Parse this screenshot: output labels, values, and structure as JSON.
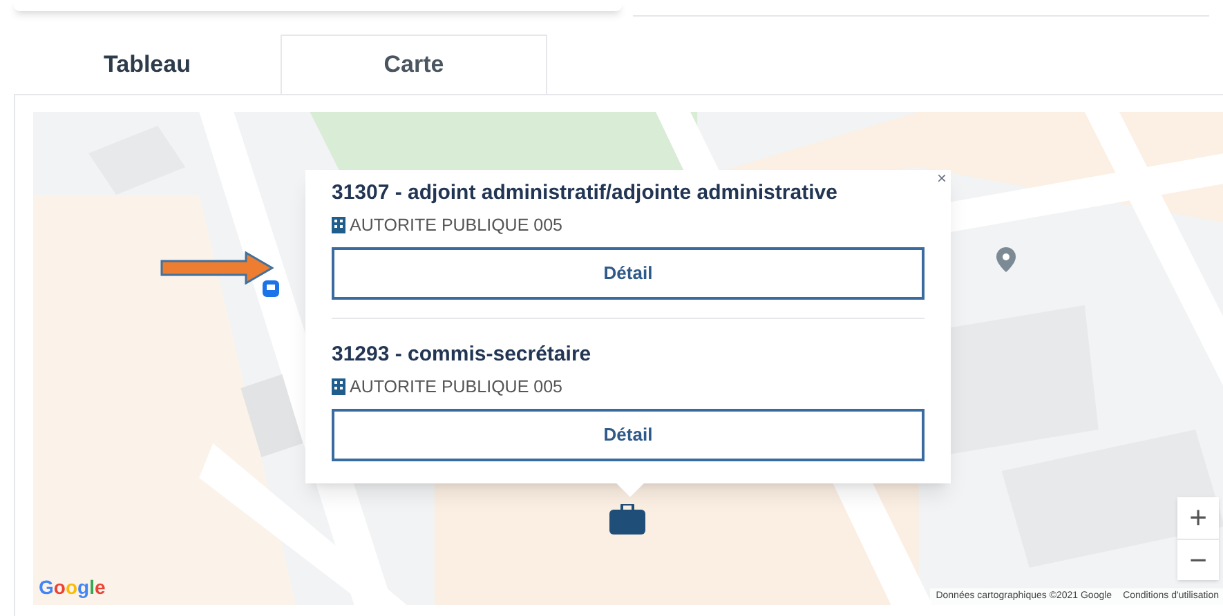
{
  "tabs": [
    {
      "label": "Tableau",
      "selected": false
    },
    {
      "label": "Carte",
      "selected": true
    }
  ],
  "map": {
    "popup": {
      "close": "×",
      "items": [
        {
          "title": "31307 - adjoint administratif/adjointe administrative",
          "employer": "AUTORITE PUBLIQUE 005",
          "button": "Détail"
        },
        {
          "title": "31293 - commis-secrétaire",
          "employer": "AUTORITE PUBLIQUE 005",
          "button": "Détail"
        }
      ]
    },
    "zoom": {
      "in": "+",
      "out": "−"
    },
    "logo": "Google",
    "attribution": "Données cartographiques ©2021 Google",
    "terms": "Conditions d'utilisation"
  }
}
